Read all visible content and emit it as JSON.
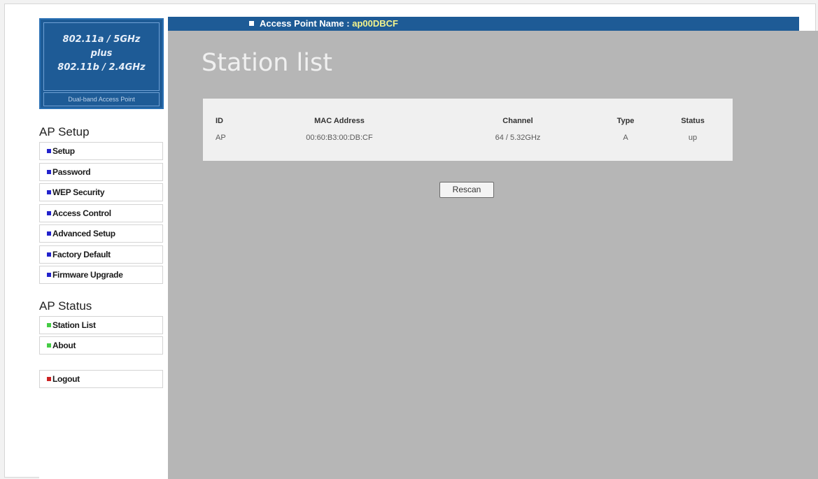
{
  "colors": {
    "brand_blue": "#1e5b96",
    "ap_name_yellow": "#f4f48c",
    "content_gray": "#b6b6b6",
    "setup_square": "#2222cc",
    "status_square": "#44cc44",
    "logout_square": "#cc2222"
  },
  "logo": {
    "line1": "802.11a / 5GHz",
    "line2": "plus",
    "line3": "802.11b / 2.4GHz",
    "subtitle": "Dual-band Access Point"
  },
  "header": {
    "ap_label": "Access Point Name :",
    "ap_name": "ap00DBCF"
  },
  "sidebar": {
    "setup_title": "AP Setup",
    "setup_items": [
      "Setup",
      "Password",
      "WEP Security",
      "Access Control",
      "Advanced Setup",
      "Factory Default",
      "Firmware Upgrade"
    ],
    "status_title": "AP Status",
    "status_items": [
      "Station List",
      "About"
    ],
    "logout": "Logout"
  },
  "main": {
    "title": "Station list",
    "table": {
      "headers": [
        "ID",
        "MAC Address",
        "Channel",
        "Type",
        "Status"
      ],
      "rows": [
        [
          "AP",
          "00:60:B3:00:DB:CF",
          "64 / 5.32GHz",
          "A",
          "up"
        ]
      ]
    },
    "rescan_label": "Rescan"
  }
}
